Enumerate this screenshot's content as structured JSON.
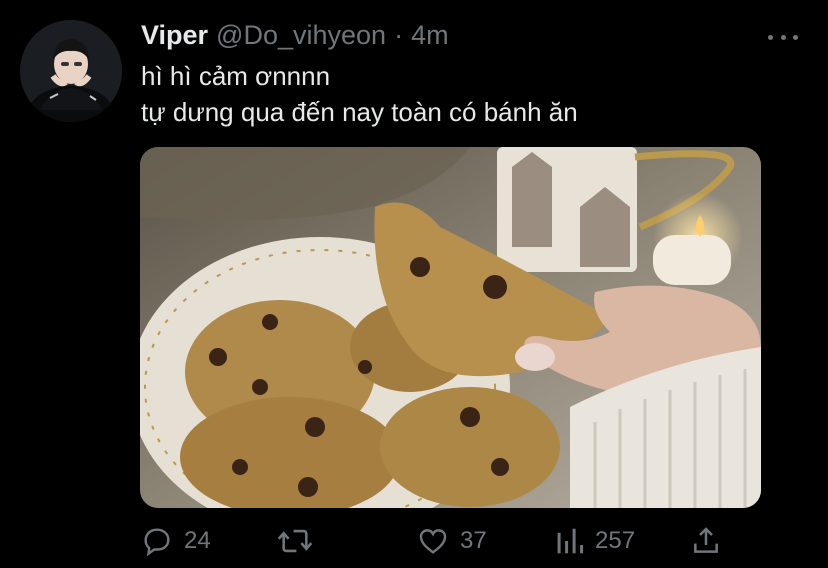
{
  "tweet": {
    "display_name": "Viper",
    "handle": "@Do_vihyeon",
    "separator": "·",
    "time": "4m",
    "text_lines": [
      "hì hì cảm ơnnnn",
      "tự dưng qua đến nay toàn có bánh ăn"
    ],
    "avatar_icon": "avatar-photo",
    "media_description_icon": "cookies-photo",
    "more_icon": "more-dots-icon"
  },
  "actions": {
    "reply_count": "24",
    "retweet_count": "",
    "like_count": "37",
    "views_count": "257",
    "icons": [
      "reply-icon",
      "retweet-icon",
      "like-icon",
      "views-icon",
      "share-icon"
    ]
  },
  "colors": {
    "background": "#000000",
    "primary_text": "#e7e9ea",
    "secondary_text": "#71767b"
  }
}
